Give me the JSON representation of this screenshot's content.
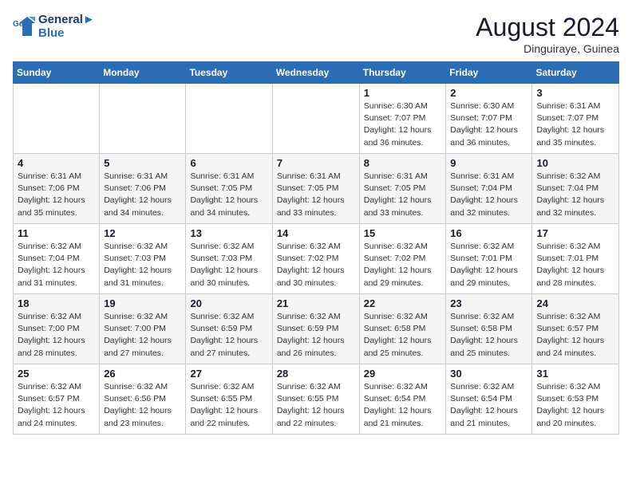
{
  "header": {
    "logo_line1": "General",
    "logo_line2": "Blue",
    "month_year": "August 2024",
    "location": "Dinguiraye, Guinea"
  },
  "weekdays": [
    "Sunday",
    "Monday",
    "Tuesday",
    "Wednesday",
    "Thursday",
    "Friday",
    "Saturday"
  ],
  "weeks": [
    [
      {
        "day": "",
        "info": ""
      },
      {
        "day": "",
        "info": ""
      },
      {
        "day": "",
        "info": ""
      },
      {
        "day": "",
        "info": ""
      },
      {
        "day": "1",
        "info": "Sunrise: 6:30 AM\nSunset: 7:07 PM\nDaylight: 12 hours\nand 36 minutes."
      },
      {
        "day": "2",
        "info": "Sunrise: 6:30 AM\nSunset: 7:07 PM\nDaylight: 12 hours\nand 36 minutes."
      },
      {
        "day": "3",
        "info": "Sunrise: 6:31 AM\nSunset: 7:07 PM\nDaylight: 12 hours\nand 35 minutes."
      }
    ],
    [
      {
        "day": "4",
        "info": "Sunrise: 6:31 AM\nSunset: 7:06 PM\nDaylight: 12 hours\nand 35 minutes."
      },
      {
        "day": "5",
        "info": "Sunrise: 6:31 AM\nSunset: 7:06 PM\nDaylight: 12 hours\nand 34 minutes."
      },
      {
        "day": "6",
        "info": "Sunrise: 6:31 AM\nSunset: 7:05 PM\nDaylight: 12 hours\nand 34 minutes."
      },
      {
        "day": "7",
        "info": "Sunrise: 6:31 AM\nSunset: 7:05 PM\nDaylight: 12 hours\nand 33 minutes."
      },
      {
        "day": "8",
        "info": "Sunrise: 6:31 AM\nSunset: 7:05 PM\nDaylight: 12 hours\nand 33 minutes."
      },
      {
        "day": "9",
        "info": "Sunrise: 6:31 AM\nSunset: 7:04 PM\nDaylight: 12 hours\nand 32 minutes."
      },
      {
        "day": "10",
        "info": "Sunrise: 6:32 AM\nSunset: 7:04 PM\nDaylight: 12 hours\nand 32 minutes."
      }
    ],
    [
      {
        "day": "11",
        "info": "Sunrise: 6:32 AM\nSunset: 7:04 PM\nDaylight: 12 hours\nand 31 minutes."
      },
      {
        "day": "12",
        "info": "Sunrise: 6:32 AM\nSunset: 7:03 PM\nDaylight: 12 hours\nand 31 minutes."
      },
      {
        "day": "13",
        "info": "Sunrise: 6:32 AM\nSunset: 7:03 PM\nDaylight: 12 hours\nand 30 minutes."
      },
      {
        "day": "14",
        "info": "Sunrise: 6:32 AM\nSunset: 7:02 PM\nDaylight: 12 hours\nand 30 minutes."
      },
      {
        "day": "15",
        "info": "Sunrise: 6:32 AM\nSunset: 7:02 PM\nDaylight: 12 hours\nand 29 minutes."
      },
      {
        "day": "16",
        "info": "Sunrise: 6:32 AM\nSunset: 7:01 PM\nDaylight: 12 hours\nand 29 minutes."
      },
      {
        "day": "17",
        "info": "Sunrise: 6:32 AM\nSunset: 7:01 PM\nDaylight: 12 hours\nand 28 minutes."
      }
    ],
    [
      {
        "day": "18",
        "info": "Sunrise: 6:32 AM\nSunset: 7:00 PM\nDaylight: 12 hours\nand 28 minutes."
      },
      {
        "day": "19",
        "info": "Sunrise: 6:32 AM\nSunset: 7:00 PM\nDaylight: 12 hours\nand 27 minutes."
      },
      {
        "day": "20",
        "info": "Sunrise: 6:32 AM\nSunset: 6:59 PM\nDaylight: 12 hours\nand 27 minutes."
      },
      {
        "day": "21",
        "info": "Sunrise: 6:32 AM\nSunset: 6:59 PM\nDaylight: 12 hours\nand 26 minutes."
      },
      {
        "day": "22",
        "info": "Sunrise: 6:32 AM\nSunset: 6:58 PM\nDaylight: 12 hours\nand 25 minutes."
      },
      {
        "day": "23",
        "info": "Sunrise: 6:32 AM\nSunset: 6:58 PM\nDaylight: 12 hours\nand 25 minutes."
      },
      {
        "day": "24",
        "info": "Sunrise: 6:32 AM\nSunset: 6:57 PM\nDaylight: 12 hours\nand 24 minutes."
      }
    ],
    [
      {
        "day": "25",
        "info": "Sunrise: 6:32 AM\nSunset: 6:57 PM\nDaylight: 12 hours\nand 24 minutes."
      },
      {
        "day": "26",
        "info": "Sunrise: 6:32 AM\nSunset: 6:56 PM\nDaylight: 12 hours\nand 23 minutes."
      },
      {
        "day": "27",
        "info": "Sunrise: 6:32 AM\nSunset: 6:55 PM\nDaylight: 12 hours\nand 22 minutes."
      },
      {
        "day": "28",
        "info": "Sunrise: 6:32 AM\nSunset: 6:55 PM\nDaylight: 12 hours\nand 22 minutes."
      },
      {
        "day": "29",
        "info": "Sunrise: 6:32 AM\nSunset: 6:54 PM\nDaylight: 12 hours\nand 21 minutes."
      },
      {
        "day": "30",
        "info": "Sunrise: 6:32 AM\nSunset: 6:54 PM\nDaylight: 12 hours\nand 21 minutes."
      },
      {
        "day": "31",
        "info": "Sunrise: 6:32 AM\nSunset: 6:53 PM\nDaylight: 12 hours\nand 20 minutes."
      }
    ]
  ]
}
